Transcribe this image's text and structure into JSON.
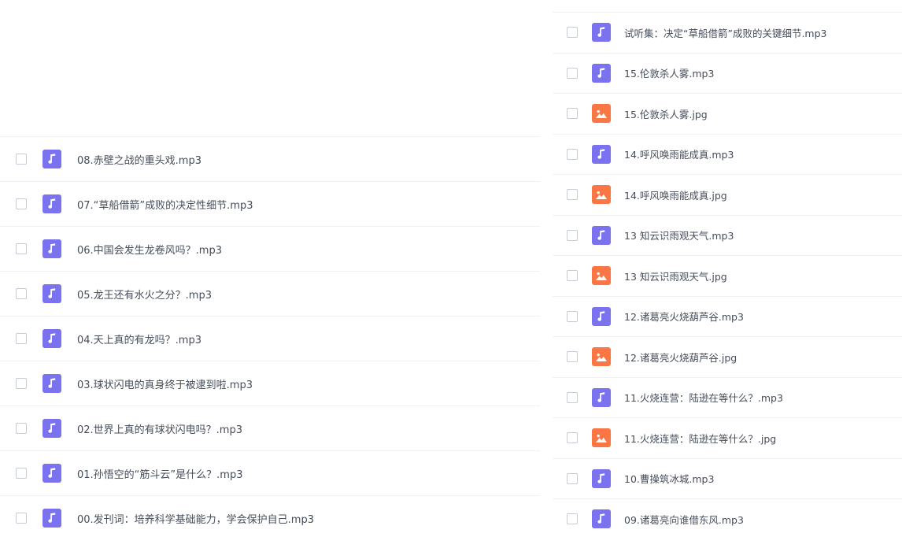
{
  "colors": {
    "audio_icon": "#7a72ee",
    "image_icon": "#fa7745",
    "text": "#454d5a",
    "checkbox_border": "#c6cbd4",
    "row_divider": "#f0f1f4"
  },
  "left_list": {
    "items": [
      {
        "name": "08.赤壁之战的重头戏.mp3",
        "type": "audio",
        "icon": "music-note-icon"
      },
      {
        "name": "07.“草船借箭”成败的决定性细节.mp3",
        "type": "audio",
        "icon": "music-note-icon"
      },
      {
        "name": "06.中国会发生龙卷风吗？.mp3",
        "type": "audio",
        "icon": "music-note-icon"
      },
      {
        "name": "05.龙王还有水火之分？.mp3",
        "type": "audio",
        "icon": "music-note-icon"
      },
      {
        "name": "04.天上真的有龙吗？.mp3",
        "type": "audio",
        "icon": "music-note-icon"
      },
      {
        "name": "03.球状闪电的真身终于被逮到啦.mp3",
        "type": "audio",
        "icon": "music-note-icon"
      },
      {
        "name": "02.世界上真的有球状闪电吗？.mp3",
        "type": "audio",
        "icon": "music-note-icon"
      },
      {
        "name": "01.孙悟空的“筋斗云”是什么？.mp3",
        "type": "audio",
        "icon": "music-note-icon"
      },
      {
        "name": "00.发刊词：培养科学基础能力，学会保护自己.mp3",
        "type": "audio",
        "icon": "music-note-icon"
      }
    ]
  },
  "right_list": {
    "items": [
      {
        "name": "试听集：决定“草船借箭”成败的关键细节.mp3",
        "type": "audio",
        "icon": "music-note-icon"
      },
      {
        "name": "15.伦敦杀人雾.mp3",
        "type": "audio",
        "icon": "music-note-icon"
      },
      {
        "name": "15.伦敦杀人雾.jpg",
        "type": "image",
        "icon": "image-icon"
      },
      {
        "name": "14.呼风唤雨能成真.mp3",
        "type": "audio",
        "icon": "music-note-icon"
      },
      {
        "name": "14.呼风唤雨能成真.jpg",
        "type": "image",
        "icon": "image-icon"
      },
      {
        "name": "13 知云识雨观天气.mp3",
        "type": "audio",
        "icon": "music-note-icon"
      },
      {
        "name": "13 知云识雨观天气.jpg",
        "type": "image",
        "icon": "image-icon"
      },
      {
        "name": "12.诸葛亮火烧葫芦谷.mp3",
        "type": "audio",
        "icon": "music-note-icon"
      },
      {
        "name": "12.诸葛亮火烧葫芦谷.jpg",
        "type": "image",
        "icon": "image-icon"
      },
      {
        "name": "11.火烧连营：陆逊在等什么？.mp3",
        "type": "audio",
        "icon": "music-note-icon"
      },
      {
        "name": "11.火烧连营：陆逊在等什么？.jpg",
        "type": "image",
        "icon": "image-icon"
      },
      {
        "name": "10.曹操筑冰城.mp3",
        "type": "audio",
        "icon": "music-note-icon"
      },
      {
        "name": "09.诸葛亮向谁借东风.mp3",
        "type": "audio",
        "icon": "music-note-icon"
      }
    ]
  }
}
